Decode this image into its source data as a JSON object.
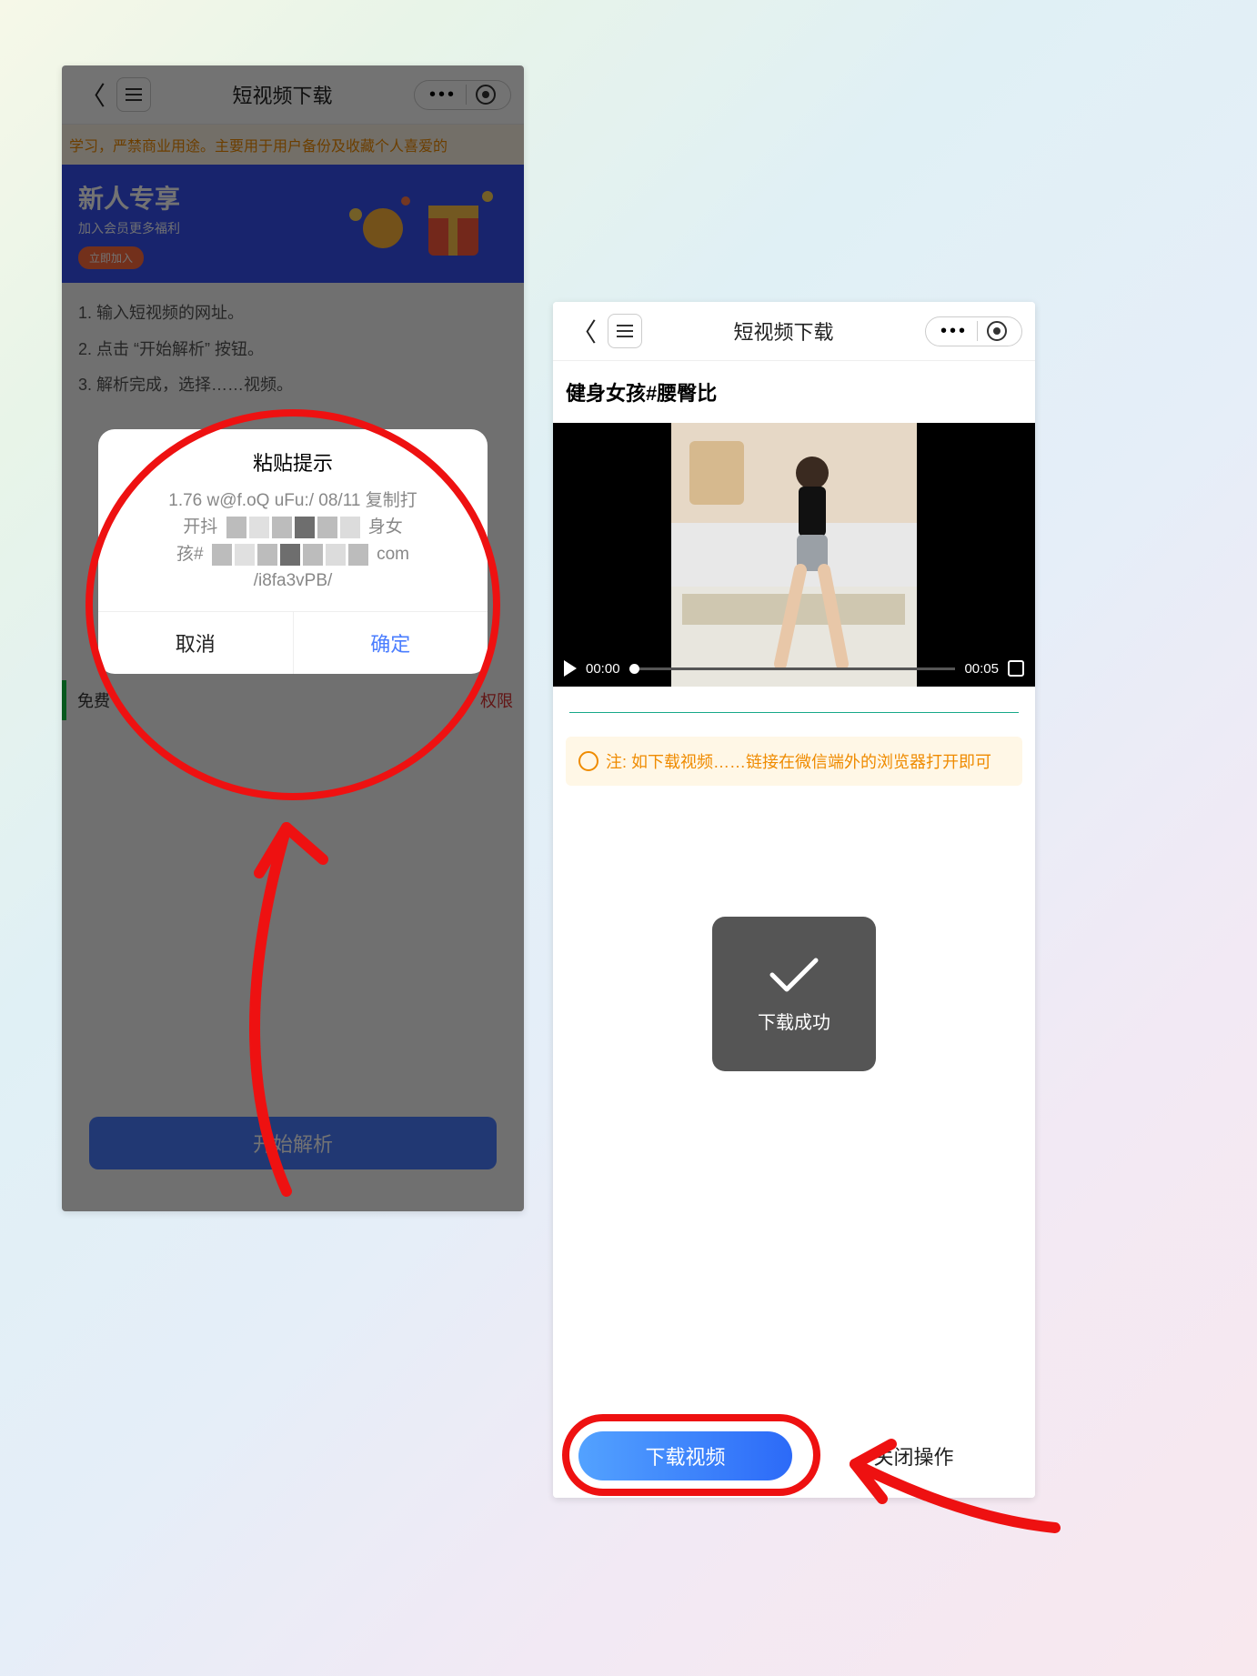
{
  "leftHeader": {
    "title": "短视频下载"
  },
  "rightHeader": {
    "title": "短视频下载"
  },
  "notice": "学习，严禁商业用途。主要用于用户备份及收藏个人喜爱的",
  "promo": {
    "title": "新人专享",
    "sub": "加入会员更多福利",
    "btn": "立即加入"
  },
  "steps": {
    "s1": "1. 输入短视频的网址。",
    "s2": "2. 点击 “开始解析” 按钮。",
    "s3": "3. 解析完成，选择……视频。"
  },
  "underBar": {
    "left": "免费",
    "right": "权限"
  },
  "startBtn": "开始解析",
  "dialog": {
    "title": "粘贴提示",
    "line1": "1.76 w@f.oQ uFu:/ 08/11 复制打",
    "line2a": "开抖",
    "line2b": "身女",
    "line3a": "孩#",
    "line3b": "com",
    "line4": "/i8fa3vPB/",
    "cancel": "取消",
    "confirm": "确定"
  },
  "video": {
    "caption": "健身女孩#腰臀比",
    "timeStart": "00:00",
    "timeEnd": "00:05"
  },
  "note": "注: 如下载视频……链接在微信端外的浏览器打开即可",
  "toast": "下载成功",
  "bottom": {
    "download": "下载视频",
    "close": "关闭操作"
  }
}
